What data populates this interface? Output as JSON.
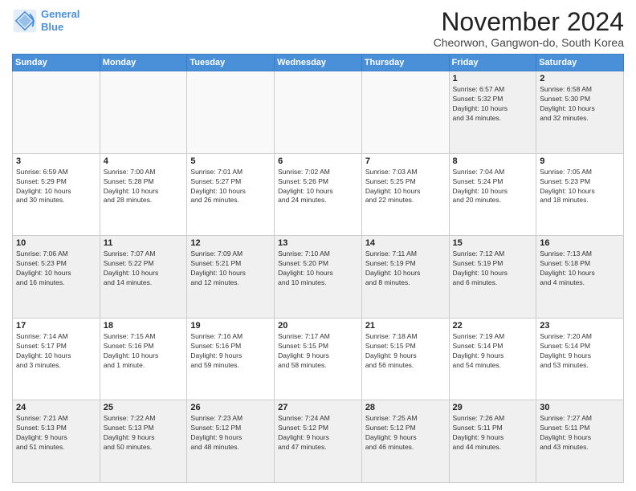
{
  "logo": {
    "line1": "General",
    "line2": "Blue"
  },
  "title": "November 2024",
  "location": "Cheorwon, Gangwon-do, South Korea",
  "weekdays": [
    "Sunday",
    "Monday",
    "Tuesday",
    "Wednesday",
    "Thursday",
    "Friday",
    "Saturday"
  ],
  "weeks": [
    [
      {
        "day": "",
        "info": ""
      },
      {
        "day": "",
        "info": ""
      },
      {
        "day": "",
        "info": ""
      },
      {
        "day": "",
        "info": ""
      },
      {
        "day": "",
        "info": ""
      },
      {
        "day": "1",
        "info": "Sunrise: 6:57 AM\nSunset: 5:32 PM\nDaylight: 10 hours\nand 34 minutes."
      },
      {
        "day": "2",
        "info": "Sunrise: 6:58 AM\nSunset: 5:30 PM\nDaylight: 10 hours\nand 32 minutes."
      }
    ],
    [
      {
        "day": "3",
        "info": "Sunrise: 6:59 AM\nSunset: 5:29 PM\nDaylight: 10 hours\nand 30 minutes."
      },
      {
        "day": "4",
        "info": "Sunrise: 7:00 AM\nSunset: 5:28 PM\nDaylight: 10 hours\nand 28 minutes."
      },
      {
        "day": "5",
        "info": "Sunrise: 7:01 AM\nSunset: 5:27 PM\nDaylight: 10 hours\nand 26 minutes."
      },
      {
        "day": "6",
        "info": "Sunrise: 7:02 AM\nSunset: 5:26 PM\nDaylight: 10 hours\nand 24 minutes."
      },
      {
        "day": "7",
        "info": "Sunrise: 7:03 AM\nSunset: 5:25 PM\nDaylight: 10 hours\nand 22 minutes."
      },
      {
        "day": "8",
        "info": "Sunrise: 7:04 AM\nSunset: 5:24 PM\nDaylight: 10 hours\nand 20 minutes."
      },
      {
        "day": "9",
        "info": "Sunrise: 7:05 AM\nSunset: 5:23 PM\nDaylight: 10 hours\nand 18 minutes."
      }
    ],
    [
      {
        "day": "10",
        "info": "Sunrise: 7:06 AM\nSunset: 5:23 PM\nDaylight: 10 hours\nand 16 minutes."
      },
      {
        "day": "11",
        "info": "Sunrise: 7:07 AM\nSunset: 5:22 PM\nDaylight: 10 hours\nand 14 minutes."
      },
      {
        "day": "12",
        "info": "Sunrise: 7:09 AM\nSunset: 5:21 PM\nDaylight: 10 hours\nand 12 minutes."
      },
      {
        "day": "13",
        "info": "Sunrise: 7:10 AM\nSunset: 5:20 PM\nDaylight: 10 hours\nand 10 minutes."
      },
      {
        "day": "14",
        "info": "Sunrise: 7:11 AM\nSunset: 5:19 PM\nDaylight: 10 hours\nand 8 minutes."
      },
      {
        "day": "15",
        "info": "Sunrise: 7:12 AM\nSunset: 5:19 PM\nDaylight: 10 hours\nand 6 minutes."
      },
      {
        "day": "16",
        "info": "Sunrise: 7:13 AM\nSunset: 5:18 PM\nDaylight: 10 hours\nand 4 minutes."
      }
    ],
    [
      {
        "day": "17",
        "info": "Sunrise: 7:14 AM\nSunset: 5:17 PM\nDaylight: 10 hours\nand 3 minutes."
      },
      {
        "day": "18",
        "info": "Sunrise: 7:15 AM\nSunset: 5:16 PM\nDaylight: 10 hours\nand 1 minute."
      },
      {
        "day": "19",
        "info": "Sunrise: 7:16 AM\nSunset: 5:16 PM\nDaylight: 9 hours\nand 59 minutes."
      },
      {
        "day": "20",
        "info": "Sunrise: 7:17 AM\nSunset: 5:15 PM\nDaylight: 9 hours\nand 58 minutes."
      },
      {
        "day": "21",
        "info": "Sunrise: 7:18 AM\nSunset: 5:15 PM\nDaylight: 9 hours\nand 56 minutes."
      },
      {
        "day": "22",
        "info": "Sunrise: 7:19 AM\nSunset: 5:14 PM\nDaylight: 9 hours\nand 54 minutes."
      },
      {
        "day": "23",
        "info": "Sunrise: 7:20 AM\nSunset: 5:14 PM\nDaylight: 9 hours\nand 53 minutes."
      }
    ],
    [
      {
        "day": "24",
        "info": "Sunrise: 7:21 AM\nSunset: 5:13 PM\nDaylight: 9 hours\nand 51 minutes."
      },
      {
        "day": "25",
        "info": "Sunrise: 7:22 AM\nSunset: 5:13 PM\nDaylight: 9 hours\nand 50 minutes."
      },
      {
        "day": "26",
        "info": "Sunrise: 7:23 AM\nSunset: 5:12 PM\nDaylight: 9 hours\nand 48 minutes."
      },
      {
        "day": "27",
        "info": "Sunrise: 7:24 AM\nSunset: 5:12 PM\nDaylight: 9 hours\nand 47 minutes."
      },
      {
        "day": "28",
        "info": "Sunrise: 7:25 AM\nSunset: 5:12 PM\nDaylight: 9 hours\nand 46 minutes."
      },
      {
        "day": "29",
        "info": "Sunrise: 7:26 AM\nSunset: 5:11 PM\nDaylight: 9 hours\nand 44 minutes."
      },
      {
        "day": "30",
        "info": "Sunrise: 7:27 AM\nSunset: 5:11 PM\nDaylight: 9 hours\nand 43 minutes."
      }
    ]
  ]
}
